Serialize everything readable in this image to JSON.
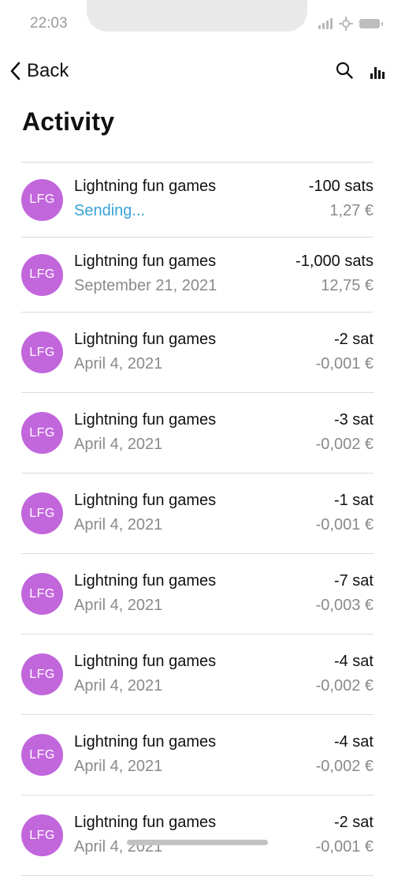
{
  "status_bar": {
    "time": "22:03"
  },
  "nav": {
    "back_label": "Back",
    "search_icon": "search-icon",
    "chart_icon": "bar-chart-icon"
  },
  "page": {
    "title": "Activity"
  },
  "colors": {
    "avatar": "#c266dc",
    "sending": "#36a3d9",
    "secondary_text": "#8a8a8a"
  },
  "transactions": [
    {
      "avatar": "LFG",
      "title": "Lightning fun games",
      "subtitle": "Sending...",
      "amount": "-100 sats",
      "fiat": "1,27 €",
      "status": "sending"
    },
    {
      "avatar": "LFG",
      "title": "Lightning fun games",
      "subtitle": "September 21, 2021",
      "amount": "-1,000 sats",
      "fiat": "12,75 €",
      "status": "done"
    },
    {
      "avatar": "LFG",
      "title": "Lightning fun games",
      "subtitle": "April 4, 2021",
      "amount": "-2 sat",
      "fiat": "-0,001 €",
      "status": "done"
    },
    {
      "avatar": "LFG",
      "title": "Lightning fun games",
      "subtitle": "April 4, 2021",
      "amount": "-3 sat",
      "fiat": "-0,002 €",
      "status": "done"
    },
    {
      "avatar": "LFG",
      "title": "Lightning fun games",
      "subtitle": "April 4, 2021",
      "amount": "-1 sat",
      "fiat": "-0,001 €",
      "status": "done"
    },
    {
      "avatar": "LFG",
      "title": "Lightning fun games",
      "subtitle": "April 4, 2021",
      "amount": "-7 sat",
      "fiat": "-0,003 €",
      "status": "done"
    },
    {
      "avatar": "LFG",
      "title": "Lightning fun games",
      "subtitle": "April 4, 2021",
      "amount": "-4 sat",
      "fiat": "-0,002 €",
      "status": "done"
    },
    {
      "avatar": "LFG",
      "title": "Lightning fun games",
      "subtitle": "April 4, 2021",
      "amount": "-4 sat",
      "fiat": "-0,002 €",
      "status": "done"
    },
    {
      "avatar": "LFG",
      "title": "Lightning fun games",
      "subtitle": "April 4, 2021",
      "amount": "-2 sat",
      "fiat": "-0,001 €",
      "status": "done"
    }
  ]
}
